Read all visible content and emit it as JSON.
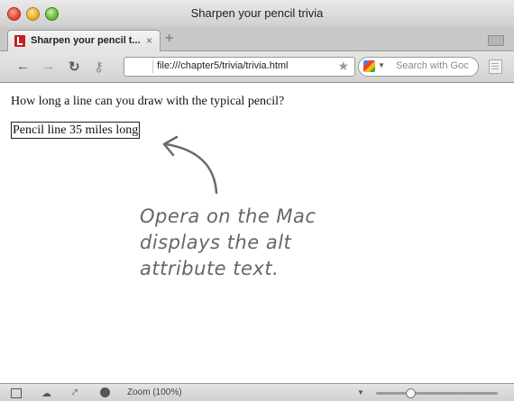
{
  "window": {
    "title": "Sharpen your pencil trivia"
  },
  "tab": {
    "label": "Sharpen your pencil t...",
    "close": "×"
  },
  "new_tab": "+",
  "url": "file:///chapter5/trivia/trivia.html",
  "search": {
    "placeholder": "Search with Goc"
  },
  "page": {
    "question": "How long a line can you draw with the typical pencil?",
    "alt_text": "Pencil line 35 miles long"
  },
  "annotation": [
    "Opera on the Mac",
    "displays the alt",
    "attribute text."
  ],
  "status": {
    "zoom_label": "Zoom (100%)",
    "zoom_value": 0.28
  },
  "icons": {
    "back": "←",
    "forward": "→",
    "reload": "↻",
    "key": "⚷",
    "star": "★",
    "dropdown": "▼",
    "cloud": "☁",
    "share": "⤤"
  }
}
